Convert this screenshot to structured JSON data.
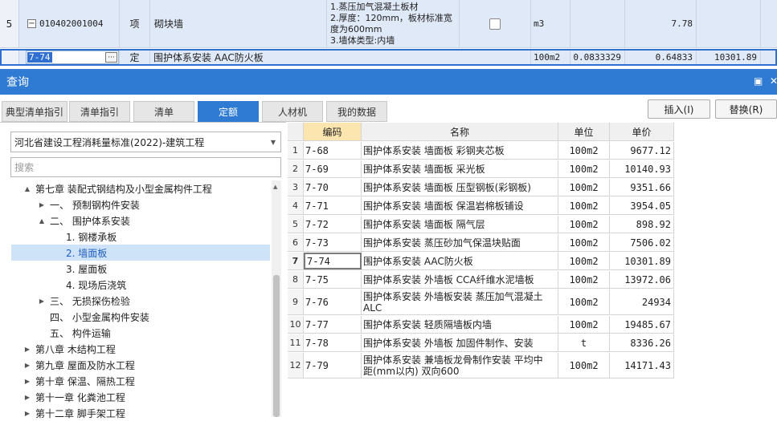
{
  "top_grid": {
    "row1": {
      "index": "5",
      "code": "010402001004",
      "type": "项",
      "name": "砌块墙",
      "feature_lines": [
        "1.蒸压加气混凝土板材",
        "2.厚度：120mm，板材标准宽",
        "度为600mm",
        "3.墙体类型:内墙"
      ],
      "unit": "m3",
      "quantity": "7.78"
    },
    "row2": {
      "code": "7-74",
      "type": "定",
      "name": "围护体系安装 AAC防火板",
      "unit": "100m2",
      "coef": "0.0833329",
      "quantity": "0.64833",
      "price": "10301.89"
    }
  },
  "panel": {
    "title": "查询"
  },
  "tabs": [
    "典型清单指引",
    "清单指引",
    "清单",
    "定额",
    "人材机",
    "我的数据"
  ],
  "buttons": {
    "insert": "插入(I)",
    "replace": "替换(R)"
  },
  "left": {
    "standard": "河北省建设工程消耗量标准(2022)-建筑工程",
    "search_placeholder": "搜索",
    "tree": [
      {
        "label": "第七章 装配式钢结构及小型金属构件工程",
        "toggle": "▲",
        "depth": 0
      },
      {
        "label": "一、 预制钢构件安装",
        "toggle": "▶",
        "depth": 1
      },
      {
        "label": "二、 围护体系安装",
        "toggle": "▲",
        "depth": 1
      },
      {
        "label": "1. 钢楼承板",
        "toggle": "",
        "depth": 2
      },
      {
        "label": "2. 墙面板",
        "toggle": "",
        "depth": 2
      },
      {
        "label": "3. 屋面板",
        "toggle": "",
        "depth": 2
      },
      {
        "label": "4. 现场后浇筑",
        "toggle": "",
        "depth": 2
      },
      {
        "label": "三、 无损探伤检验",
        "toggle": "▶",
        "depth": 1
      },
      {
        "label": "四、 小型金属构件安装",
        "toggle": "",
        "depth": 1
      },
      {
        "label": "五、 构件运输",
        "toggle": "",
        "depth": 1
      },
      {
        "label": "第八章 木结构工程",
        "toggle": "▶",
        "depth": 0
      },
      {
        "label": "第九章 屋面及防水工程",
        "toggle": "▶",
        "depth": 0
      },
      {
        "label": "第十章 保温、隔热工程",
        "toggle": "▶",
        "depth": 0
      },
      {
        "label": "第十一章 化粪池工程",
        "toggle": "▶",
        "depth": 0
      },
      {
        "label": "第十二章 脚手架工程",
        "toggle": "▶",
        "depth": 0
      }
    ]
  },
  "table": {
    "headers": [
      "编码",
      "名称",
      "单位",
      "单价"
    ],
    "rows": [
      {
        "n": "1",
        "code": "7-68",
        "name": "围护体系安装 墙面板 彩钢夹芯板",
        "unit": "100m2",
        "price": "9677.12"
      },
      {
        "n": "2",
        "code": "7-69",
        "name": "围护体系安装 墙面板 采光板",
        "unit": "100m2",
        "price": "10140.93"
      },
      {
        "n": "3",
        "code": "7-70",
        "name": "围护体系安装 墙面板 压型钢板(彩钢板)",
        "unit": "100m2",
        "price": "9351.66"
      },
      {
        "n": "4",
        "code": "7-71",
        "name": "围护体系安装 墙面板 保温岩棉板铺设",
        "unit": "100m2",
        "price": "3954.05"
      },
      {
        "n": "5",
        "code": "7-72",
        "name": "围护体系安装 墙面板 隔气层",
        "unit": "100m2",
        "price": "898.92"
      },
      {
        "n": "6",
        "code": "7-73",
        "name": "围护体系安装 蒸压砂加气保温块贴面",
        "unit": "100m2",
        "price": "7506.02"
      },
      {
        "n": "7",
        "code": "7-74",
        "name": "围护体系安装 AAC防火板",
        "unit": "100m2",
        "price": "10301.89"
      },
      {
        "n": "8",
        "code": "7-75",
        "name": "围护体系安装 外墙板 CCA纤维水泥墙板",
        "unit": "100m2",
        "price": "13972.06"
      },
      {
        "n": "9",
        "code": "7-76",
        "name": "围护体系安装 外墙板安装 蒸压加气混凝土",
        "name2": "ALC",
        "unit": "100m2",
        "price": "24934"
      },
      {
        "n": "10",
        "code": "7-77",
        "name": "围护体系安装 轻质隔墙板内墙",
        "unit": "100m2",
        "price": "19485.67"
      },
      {
        "n": "11",
        "code": "7-78",
        "name": "围护体系安装 外墙板 加固件制作、安装",
        "unit": "t",
        "price": "8336.26"
      },
      {
        "n": "12",
        "code": "7-79",
        "name": "围护体系安装 兼墙板龙骨制作安装 平均中",
        "name2": "距(mm以内) 双向600",
        "unit": "100m2",
        "price": "14171.43"
      }
    ]
  }
}
